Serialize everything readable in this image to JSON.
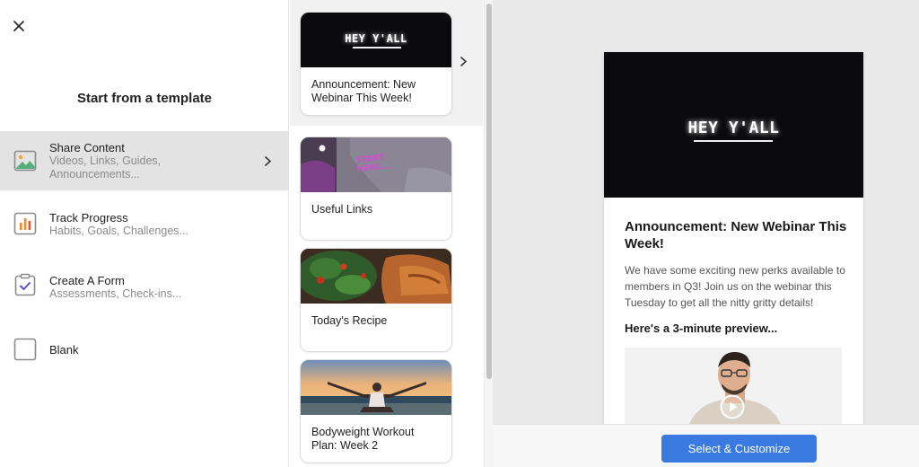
{
  "panel": {
    "title": "Start from a template"
  },
  "categories": [
    {
      "label": "Share Content",
      "sub": "Videos, Links, Guides,",
      "sub2": "Announcements...",
      "icon": "image-icon",
      "active": true
    },
    {
      "label": "Track Progress",
      "sub": "Habits, Goals, Challenges...",
      "icon": "bar-chart-icon"
    },
    {
      "label": "Create A Form",
      "sub": "Assessments, Check-ins...",
      "icon": "clipboard-check-icon"
    },
    {
      "label": "Blank",
      "icon": "blank-square-icon"
    }
  ],
  "templates": [
    {
      "title": "Announcement: New Webinar This Week!",
      "thumb_text": "HEY Y'ALL"
    },
    {
      "title": "Useful Links",
      "thumb_text": "START HERE..."
    },
    {
      "title": "Today's Recipe"
    },
    {
      "title": "Bodyweight Workout Plan: Week 2"
    }
  ],
  "preview": {
    "hero_text": "HEY Y'ALL",
    "title": "Announcement: New Webinar This Week!",
    "description": "We have some exciting new perks available to members in Q3! Join us on the webinar this Tuesday to get all the nitty gritty details!",
    "subheading": "Here's a 3-minute preview..."
  },
  "footer": {
    "cta_label": "Select & Customize"
  },
  "colors": {
    "accent": "#3a7ae0",
    "active_row": "#e3e3e3",
    "preview_bg": "#e9e9e9"
  }
}
